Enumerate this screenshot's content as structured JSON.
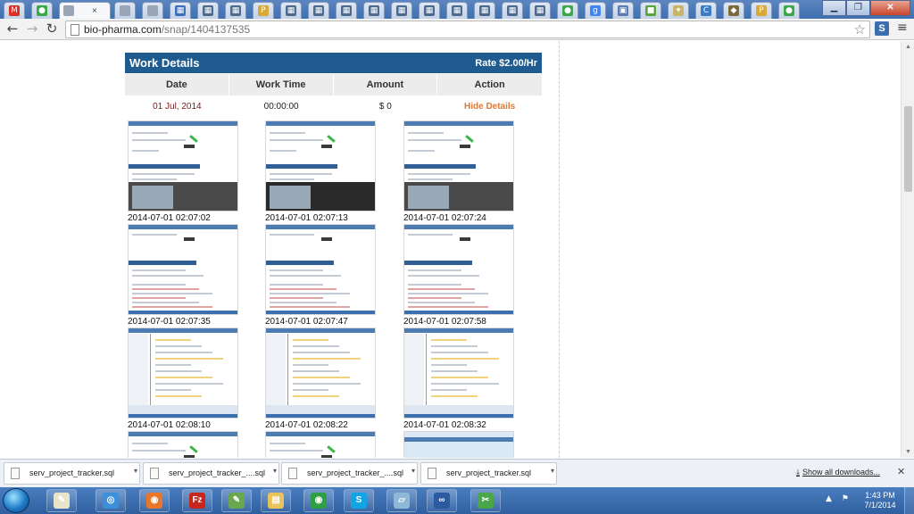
{
  "browser": {
    "tabs": [
      {
        "icon": "gmail-icon",
        "color": "#d93025",
        "glyph": "M"
      },
      {
        "icon": "green-circle-icon",
        "color": "#3aa84a",
        "glyph": "●"
      },
      {
        "icon": "blank-page-icon",
        "color": "#9aa5b5",
        "glyph": ""
      },
      {
        "icon": "blank-page-icon",
        "color": "#9aa5b5",
        "glyph": ""
      },
      {
        "icon": "blank-page-icon",
        "color": "#9aa5b5",
        "glyph": ""
      },
      {
        "icon": "grid-app-icon",
        "color": "#3d6fb8",
        "glyph": "▦"
      },
      {
        "icon": "grid-app-icon",
        "color": "#4b6a8d",
        "glyph": "▦"
      },
      {
        "icon": "grid-app-icon",
        "color": "#4b6a8d",
        "glyph": "▦"
      },
      {
        "icon": "pma-icon",
        "color": "#d6a93a",
        "glyph": "P"
      },
      {
        "icon": "grid-app-icon",
        "color": "#4b6a8d",
        "glyph": "▦"
      },
      {
        "icon": "grid-app-icon",
        "color": "#4b6a8d",
        "glyph": "▦"
      },
      {
        "icon": "grid-app-icon",
        "color": "#4b6a8d",
        "glyph": "▦"
      },
      {
        "icon": "grid-app-icon",
        "color": "#4b6a8d",
        "glyph": "▦"
      },
      {
        "icon": "grid-app-icon",
        "color": "#4b6a8d",
        "glyph": "▦"
      },
      {
        "icon": "grid-app-icon",
        "color": "#4b6a8d",
        "glyph": "▦"
      },
      {
        "icon": "grid-app-icon",
        "color": "#4b6a8d",
        "glyph": "▦"
      },
      {
        "icon": "grid-app-icon",
        "color": "#4b6a8d",
        "glyph": "▦"
      },
      {
        "icon": "grid-app-icon",
        "color": "#4b6a8d",
        "glyph": "▦"
      },
      {
        "icon": "grid-app-icon",
        "color": "#4b6a8d",
        "glyph": "▦"
      },
      {
        "icon": "green-circle-icon",
        "color": "#3aa84a",
        "glyph": "●"
      },
      {
        "icon": "google-icon",
        "color": "#4285f4",
        "glyph": "g"
      },
      {
        "icon": "photo-icon",
        "color": "#5a7cb0",
        "glyph": "▣"
      },
      {
        "icon": "green-app-icon",
        "color": "#5aa33c",
        "glyph": "■"
      },
      {
        "icon": "lamp-icon",
        "color": "#c8b46a",
        "glyph": "✦"
      },
      {
        "icon": "csharp-icon",
        "color": "#3b7dc4",
        "glyph": "C"
      },
      {
        "icon": "mascot-icon",
        "color": "#7a6b3a",
        "glyph": "◆"
      },
      {
        "icon": "pma-icon",
        "color": "#d6a93a",
        "glyph": "P"
      },
      {
        "icon": "green-circle-icon",
        "color": "#3aa84a",
        "glyph": "●"
      },
      {
        "icon": "blank-page-icon",
        "color": "#9aa5b5",
        "glyph": ""
      }
    ],
    "active_tab_close": "×",
    "url_host": "bio-pharma.com",
    "url_path": "/snap/1404137535",
    "back_glyph": "←",
    "forward_glyph": "→",
    "reload_glyph": "↻",
    "star_glyph": "☆",
    "extension_label": "S",
    "menu_glyph": "≡",
    "win_minimize": "▁",
    "win_restore": "❐",
    "win_close": "✕"
  },
  "work_details": {
    "title": "Work Details",
    "rate": "Rate $2.00/Hr",
    "columns": [
      "Date",
      "Work Time",
      "Amount",
      "Action"
    ],
    "row": {
      "date": "01 Jul, 2014",
      "work_time": "00:00:00",
      "amount": "$ 0",
      "action": "Hide Details"
    }
  },
  "screenshots": [
    {
      "time": "2014-07-01 02:07:02",
      "variant": "site"
    },
    {
      "time": "2014-07-01 02:07:13",
      "variant": "site-dark"
    },
    {
      "time": "2014-07-01 02:07:24",
      "variant": "site"
    },
    {
      "time": "2014-07-01 02:07:35",
      "variant": "code"
    },
    {
      "time": "2014-07-01 02:07:47",
      "variant": "code"
    },
    {
      "time": "2014-07-01 02:07:58",
      "variant": "code"
    },
    {
      "time": "2014-07-01 02:08:10",
      "variant": "files"
    },
    {
      "time": "2014-07-01 02:08:22",
      "variant": "files"
    },
    {
      "time": "2014-07-01 02:08:32",
      "variant": "files"
    },
    {
      "time": "",
      "variant": "site"
    },
    {
      "time": "",
      "variant": "site"
    },
    {
      "time": "",
      "variant": "blue"
    }
  ],
  "downloads": {
    "items": [
      "serv_project_tracker.sql",
      "serv_project_tracker_....sql",
      "serv_project_tracker_....sql",
      "serv_project_tracker.sql"
    ],
    "caret": "▾",
    "show_all": "Show all downloads...",
    "show_all_glyph": "⤓",
    "close": "✕"
  },
  "taskbar": {
    "apps": [
      {
        "icon": "paint-icon",
        "color": "#e9e3c9",
        "glyph": "✎"
      },
      {
        "icon": "safari-icon",
        "color": "#3c8fd8",
        "glyph": "◎"
      },
      {
        "icon": "firefox-icon",
        "color": "#e8762b",
        "glyph": "◉"
      },
      {
        "icon": "filezilla-icon",
        "color": "#c8251d",
        "glyph": "Fz"
      },
      {
        "icon": "notepad-icon",
        "color": "#6aa84f",
        "glyph": "✎"
      },
      {
        "icon": "explorer-icon",
        "color": "#e8c25a",
        "glyph": "▤"
      },
      {
        "icon": "chrome-icon",
        "color": "#2f9e44",
        "glyph": "◉"
      },
      {
        "icon": "skype-icon",
        "color": "#12a5e6",
        "glyph": "S"
      },
      {
        "icon": "notes-icon",
        "color": "#8fb7d8",
        "glyph": "▱"
      },
      {
        "icon": "connect-icon",
        "color": "#2c5aa0",
        "glyph": "∞"
      },
      {
        "icon": "snip-icon",
        "color": "#4ba64a",
        "glyph": "✂"
      }
    ],
    "tray_arrow": "▲",
    "tray_flag": "⚑",
    "time": "1:43 PM",
    "date": "7/1/2014"
  }
}
